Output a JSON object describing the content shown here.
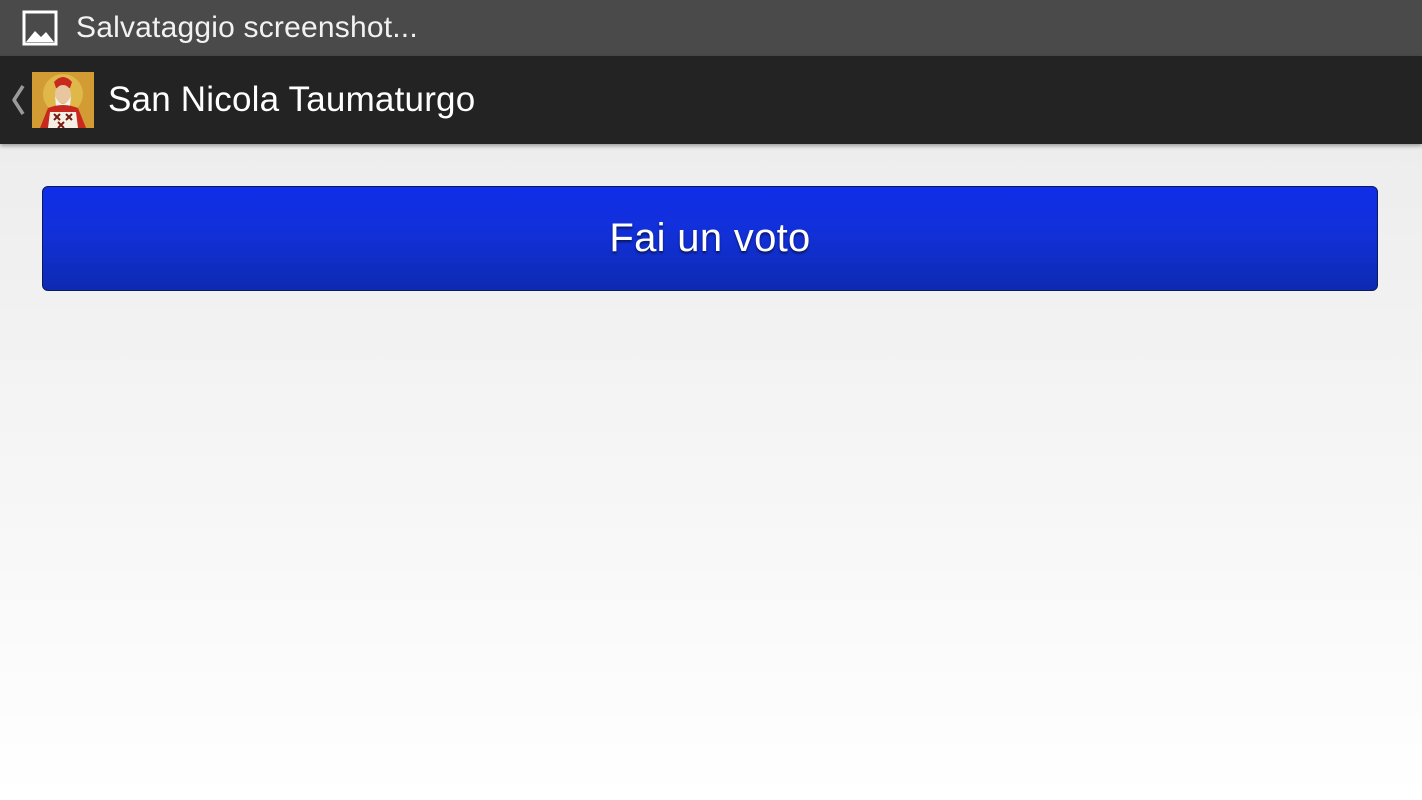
{
  "status_bar": {
    "icon": "image-icon",
    "text": "Salvataggio screenshot..."
  },
  "action_bar": {
    "up_icon": "chevron-left-icon",
    "app_icon": "saint-nicholas-icon",
    "title": "San Nicola Taumaturgo"
  },
  "main": {
    "vote_button_label": "Fai un voto"
  },
  "colors": {
    "status_bar_bg": "#4a4a4a",
    "action_bar_bg": "#232323",
    "button_blue": "#1230d8"
  }
}
